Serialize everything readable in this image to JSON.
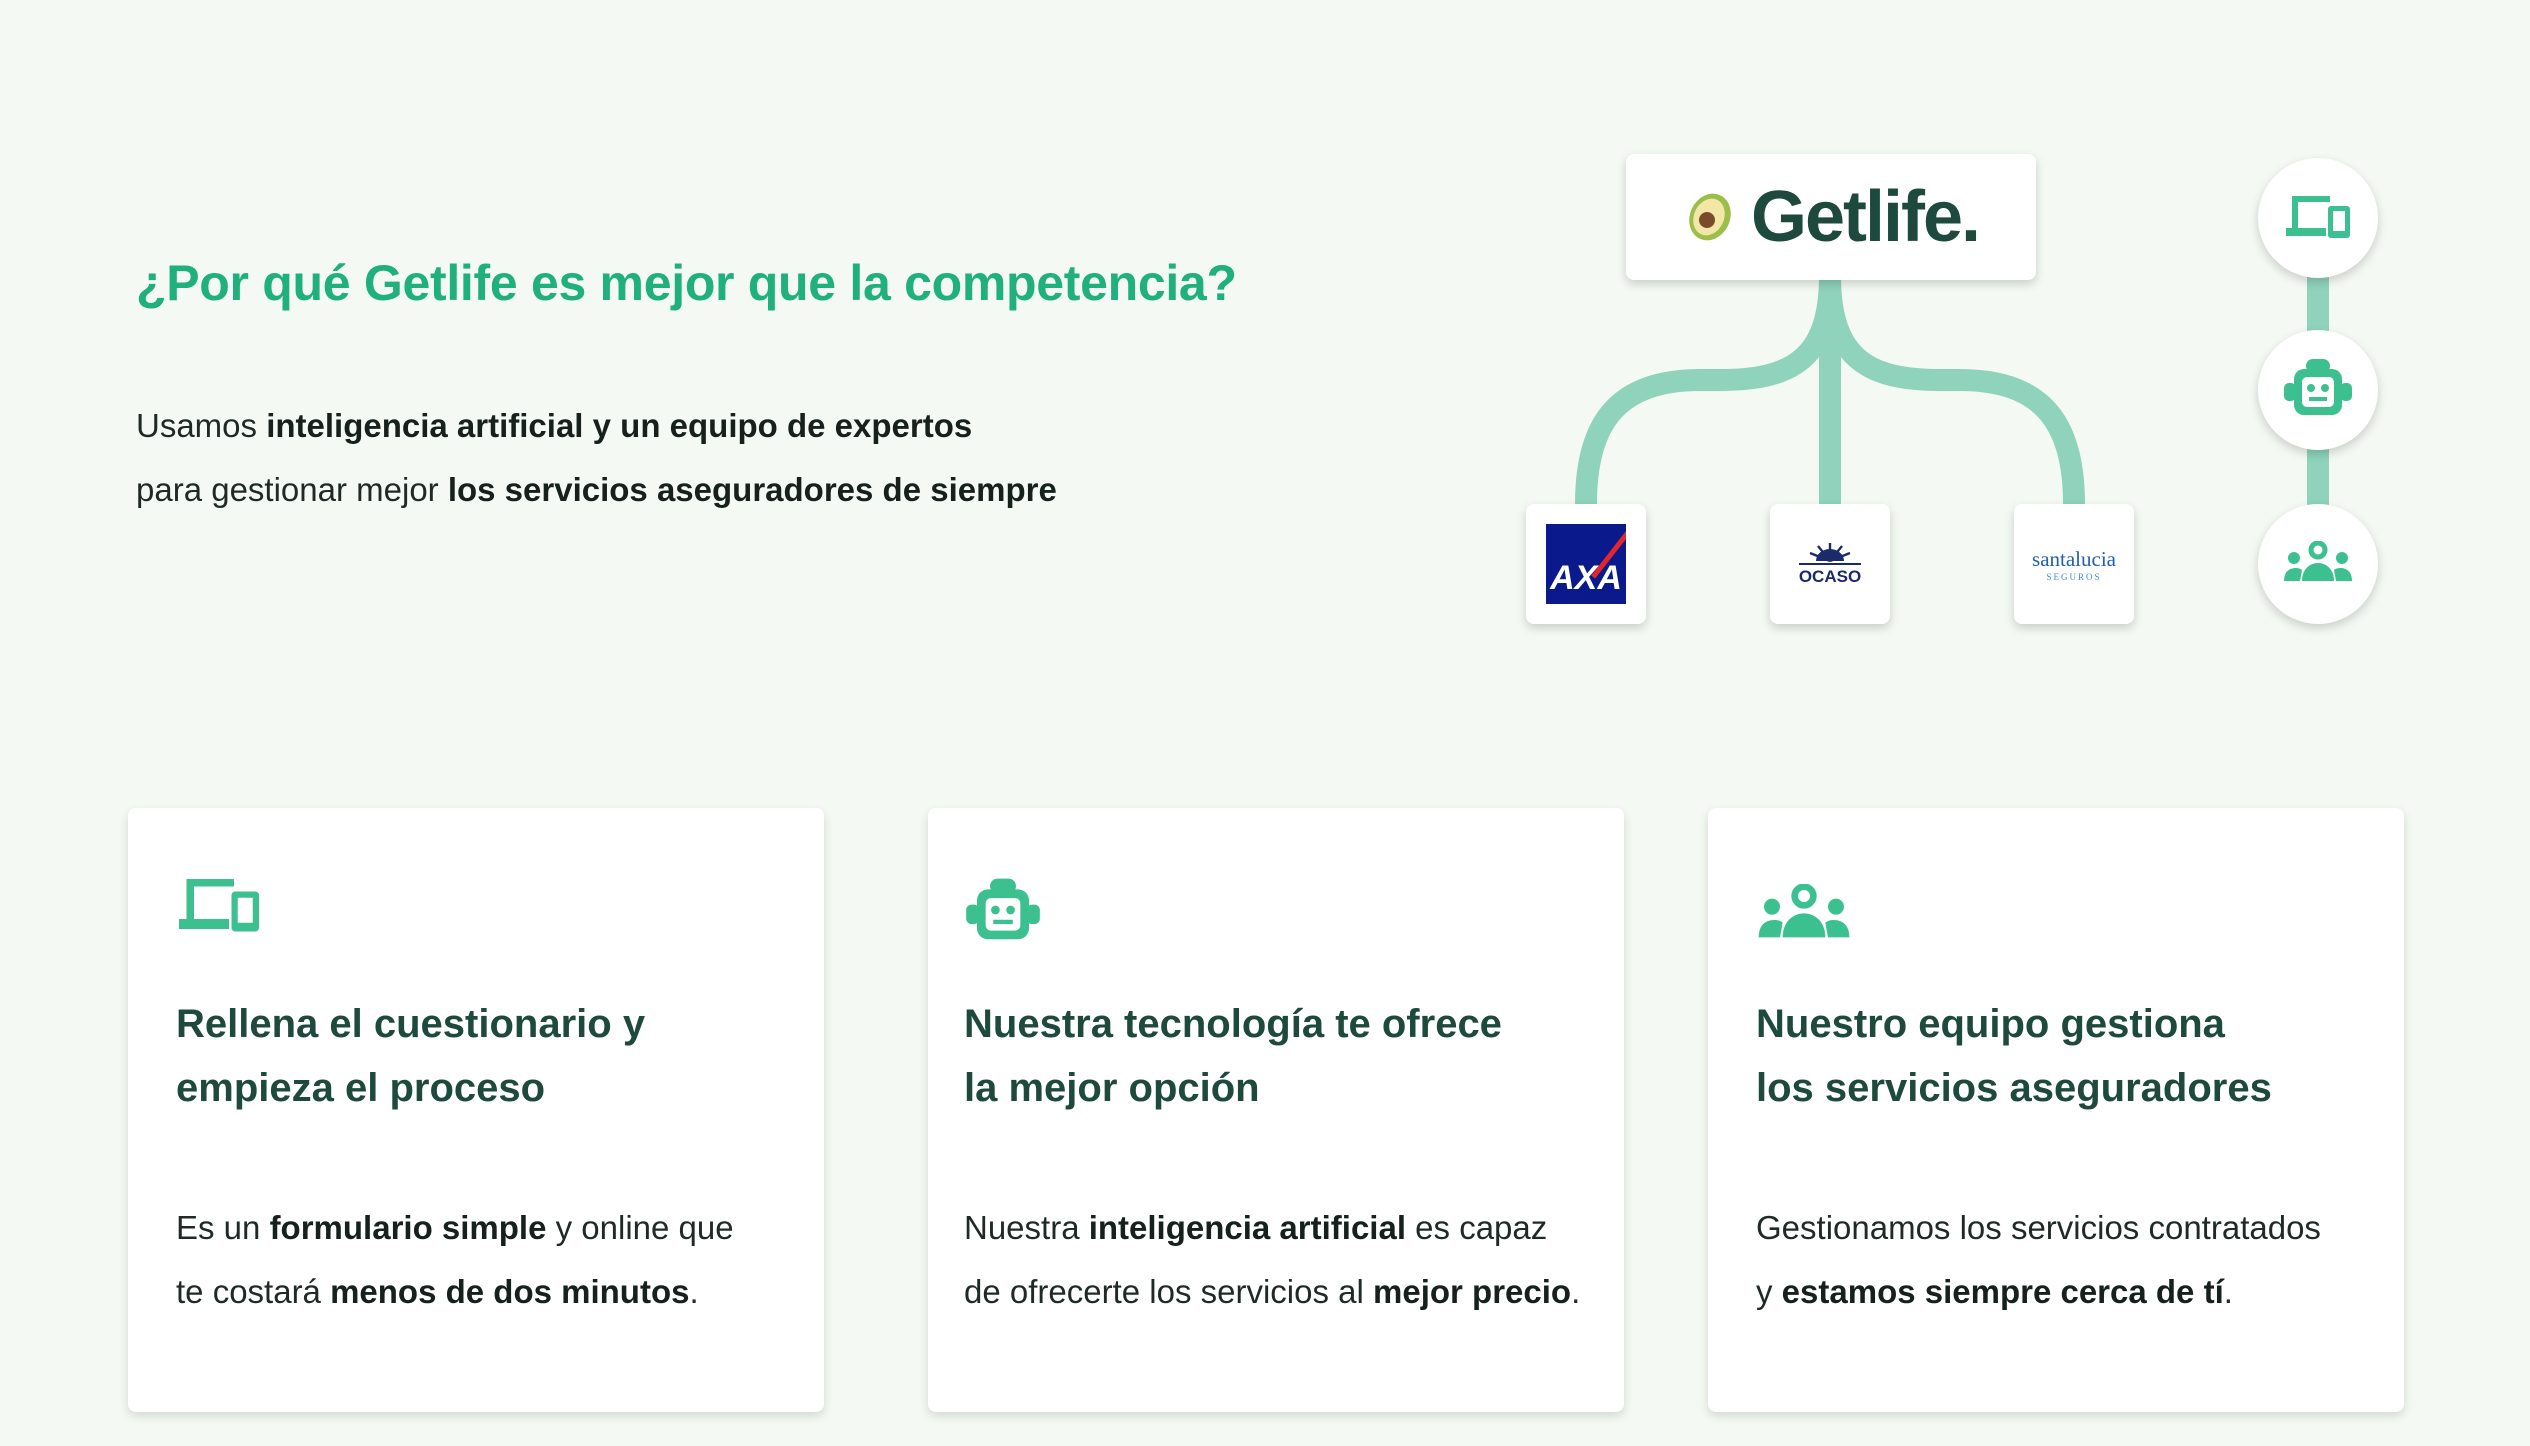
{
  "hero": {
    "title": "¿Por qué Getlife es mejor que la competencia?",
    "line1_prefix": "Usamos ",
    "line1_bold": "inteligencia artificial y un equipo de expertos",
    "line2_prefix": "para gestionar mejor ",
    "line2_bold": "los servicios aseguradores de siempre"
  },
  "diagram": {
    "brand": "Getlife.",
    "brand_icon": "avocado-icon",
    "connector_color": "#8fd3bc",
    "insurers": [
      {
        "name": "AXA",
        "label": "AXA"
      },
      {
        "name": "Ocaso",
        "label": "OCASO"
      },
      {
        "name": "Santalucía",
        "label": "santalucia",
        "sub": "SEGUROS"
      }
    ],
    "steps_icons": [
      "devices-icon",
      "robot-icon",
      "team-icon"
    ]
  },
  "cards": [
    {
      "icon": "devices-icon",
      "title_line1": "Rellena el cuestionario y",
      "title_line2": "empieza el proceso",
      "t1": "Es un ",
      "b1": "formulario simple",
      "t2": " y online que",
      "t3": "te costará ",
      "b2": "menos de dos minutos",
      "t4": "."
    },
    {
      "icon": "robot-icon",
      "title_line1": "Nuestra tecnología te ofrece",
      "title_line2": "la mejor opción",
      "t1": "Nuestra ",
      "b1": "inteligencia artificial",
      "t2": " es capaz",
      "t3": "de ofrecerte los servicios al ",
      "b2": "mejor precio",
      "t4": "."
    },
    {
      "icon": "team-icon",
      "title_line1": "Nuestro equipo gestiona",
      "title_line2": "los servicios aseguradores",
      "t1": "Gestionamos los servicios contratados",
      "b1": "",
      "t2": "",
      "t3": "y ",
      "b2": "estamos siempre cerca de tí",
      "t4": "."
    }
  ],
  "colors": {
    "accent": "#1fb07d",
    "dark_green": "#1e4a3e",
    "icon_green": "#3cc08f",
    "background": "#f4faf3"
  }
}
